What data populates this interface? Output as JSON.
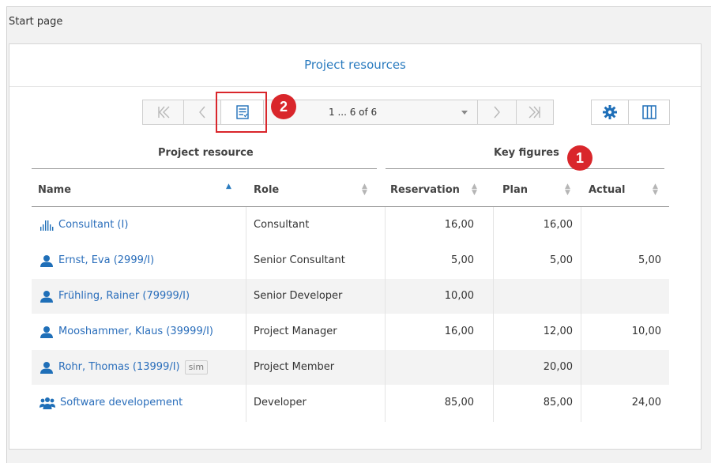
{
  "page": {
    "title": "Start page"
  },
  "panel": {
    "title": "Project resources"
  },
  "pager": {
    "first_icon": "first-page-icon",
    "prev_icon": "prev-page-icon",
    "list_icon": "list-view-icon",
    "range_text": "1 ... 6 of 6",
    "next_icon": "next-page-icon",
    "last_icon": "last-page-icon"
  },
  "tools": {
    "settings_icon": "gear-icon",
    "columns_icon": "columns-icon"
  },
  "callouts": {
    "one": "1",
    "two": "2",
    "color": "#d9262b"
  },
  "groups": {
    "resource": "Project resource",
    "figures": "Key figures"
  },
  "columns": {
    "name": "Name",
    "role": "Role",
    "reservation": "Reservation",
    "plan": "Plan",
    "actual": "Actual"
  },
  "rows": [
    {
      "name": "Consultant (I)",
      "icon": "role-icon",
      "role": "Consultant",
      "reservation": "16,00",
      "plan": "16,00",
      "actual": ""
    },
    {
      "name": "Ernst, Eva (2999/I)",
      "icon": "person-icon",
      "role": "Senior Consultant",
      "reservation": "5,00",
      "plan": "5,00",
      "actual": "5,00"
    },
    {
      "name": "Frühling, Rainer (79999/I)",
      "icon": "person-icon",
      "role": "Senior Developer",
      "reservation": "10,00",
      "plan": "",
      "actual": ""
    },
    {
      "name": "Mooshammer, Klaus (39999/I)",
      "icon": "person-icon",
      "role": "Project Manager",
      "reservation": "16,00",
      "plan": "12,00",
      "actual": "10,00"
    },
    {
      "name": "Rohr, Thomas (13999/I)",
      "icon": "person-icon",
      "tag": "sim",
      "role": "Project Member",
      "reservation": "",
      "plan": "20,00",
      "actual": ""
    },
    {
      "name": "Software developement",
      "icon": "team-icon",
      "role": "Developer",
      "reservation": "85,00",
      "plan": "85,00",
      "actual": "24,00"
    }
  ],
  "colors": {
    "link": "#2a6ebb",
    "title": "#2a7bbf",
    "accent": "#1f6fb8"
  }
}
